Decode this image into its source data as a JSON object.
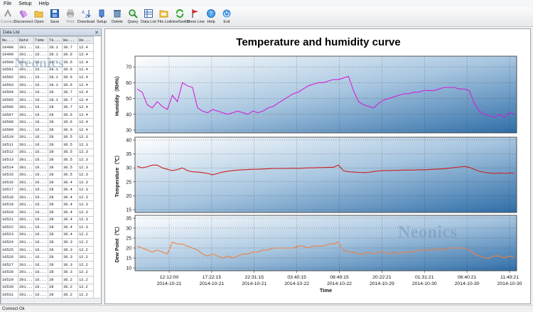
{
  "menu": [
    "File",
    "Setup",
    "Help"
  ],
  "toolbar": [
    {
      "label": "Connect",
      "icon": "connect-icon",
      "disabled": true
    },
    {
      "label": "Disconnect",
      "icon": "disconnect-icon",
      "disabled": false
    },
    {
      "label": "Open",
      "icon": "folder-open-icon",
      "disabled": false
    },
    {
      "label": "Save",
      "icon": "save-icon",
      "disabled": false
    },
    {
      "label": "Print",
      "icon": "print-icon",
      "disabled": true
    },
    {
      "label": "Download",
      "icon": "download-icon",
      "disabled": false
    },
    {
      "label": "Setup",
      "icon": "setup-icon",
      "disabled": false
    },
    {
      "label": "Delete",
      "icon": "delete-icon",
      "disabled": false
    },
    {
      "label": "Query",
      "icon": "query-icon",
      "disabled": false
    },
    {
      "label": "Data List",
      "icon": "data-list-icon",
      "disabled": false
    },
    {
      "label": "File List",
      "icon": "file-list-icon",
      "disabled": false
    },
    {
      "label": "ViewSwitch",
      "icon": "view-switch-icon",
      "disabled": false
    },
    {
      "label": "Show Line",
      "icon": "show-line-icon",
      "disabled": false
    },
    {
      "label": "Help",
      "icon": "help-icon",
      "disabled": false
    },
    {
      "label": "Exit",
      "icon": "exit-icon",
      "disabled": false
    }
  ],
  "data_list": {
    "title": "Data List",
    "columns": [
      "Nu...",
      "Date",
      "Time",
      "Te...",
      "Hu...",
      "De..."
    ],
    "rows": [
      [
        "10498",
        "201...",
        "16...",
        "28.1",
        "36.7",
        "12.4"
      ],
      [
        "10499",
        "201...",
        "16...",
        "28.1",
        "36.6",
        "12.4"
      ],
      [
        "10500",
        "201...",
        "16...",
        "28.1",
        "36.6",
        "12.4"
      ],
      [
        "10501",
        "201...",
        "16...",
        "28.1",
        "36.6",
        "12.4"
      ],
      [
        "10502",
        "201...",
        "16...",
        "28.1",
        "36.6",
        "12.4"
      ],
      [
        "10503",
        "201...",
        "16...",
        "28.1",
        "36.6",
        "12.4"
      ],
      [
        "10504",
        "201...",
        "16...",
        "28",
        "36.7",
        "12.4"
      ],
      [
        "10505",
        "201...",
        "16...",
        "28.1",
        "36.7",
        "12.4"
      ],
      [
        "10506",
        "201...",
        "16...",
        "28",
        "36.7",
        "12.4"
      ],
      [
        "10507",
        "201...",
        "16...",
        "28",
        "36.6",
        "12.4"
      ],
      [
        "10508",
        "201...",
        "16...",
        "28",
        "36.6",
        "12.4"
      ],
      [
        "10509",
        "201...",
        "16...",
        "28",
        "36.6",
        "12.4"
      ],
      [
        "10510",
        "201...",
        "16...",
        "28",
        "36.5",
        "12.3"
      ],
      [
        "10511",
        "201...",
        "16...",
        "28",
        "36.5",
        "12.3"
      ],
      [
        "10512",
        "201...",
        "16...",
        "28",
        "36.5",
        "12.3"
      ],
      [
        "10513",
        "201...",
        "16...",
        "28",
        "36.5",
        "12.3"
      ],
      [
        "10514",
        "201...",
        "16...",
        "28",
        "36.5",
        "12.3"
      ],
      [
        "10515",
        "201...",
        "16...",
        "28",
        "36.5",
        "12.3"
      ],
      [
        "10516",
        "201...",
        "16...",
        "28",
        "36.4",
        "12.3"
      ],
      [
        "10517",
        "201...",
        "16...",
        "28",
        "36.4",
        "12.3"
      ],
      [
        "10518",
        "201...",
        "16...",
        "28",
        "36.4",
        "12.3"
      ],
      [
        "10519",
        "201...",
        "16...",
        "28",
        "36.4",
        "12.3"
      ],
      [
        "10520",
        "201...",
        "16...",
        "28",
        "36.4",
        "12.3"
      ],
      [
        "10521",
        "201...",
        "16...",
        "28",
        "36.4",
        "12.3"
      ],
      [
        "10522",
        "201...",
        "16...",
        "28",
        "36.4",
        "12.3"
      ],
      [
        "10523",
        "201...",
        "16...",
        "28",
        "36.4",
        "12.2"
      ],
      [
        "10524",
        "201...",
        "16...",
        "28",
        "36.3",
        "12.2"
      ],
      [
        "10525",
        "201...",
        "16...",
        "28",
        "36.3",
        "12.2"
      ],
      [
        "10526",
        "201...",
        "16...",
        "28",
        "36.3",
        "12.2"
      ],
      [
        "10527",
        "201...",
        "16...",
        "28",
        "36.3",
        "12.2"
      ],
      [
        "10528",
        "201...",
        "16...",
        "28",
        "36.3",
        "12.2"
      ],
      [
        "10529",
        "201...",
        "16...",
        "28",
        "36.2",
        "12.2"
      ],
      [
        "10530",
        "201...",
        "16...",
        "28",
        "36.2",
        "12.2"
      ],
      [
        "10531",
        "201...",
        "16...",
        "28",
        "36.2",
        "12.2"
      ],
      [
        "10532",
        "201...",
        "16...",
        "28",
        "36.2",
        "12.2"
      ]
    ]
  },
  "watermark": "Neonics",
  "status": "Connect Ok",
  "chart_data": {
    "type": "line",
    "title": "Temperature and humidity curve",
    "xlabel": "Time",
    "x_ticks": [
      {
        "time": "12:12:00",
        "date": "2014-10-21"
      },
      {
        "time": "17:22:15",
        "date": "2014-10-21"
      },
      {
        "time": "22:31:15",
        "date": "2014-10-21"
      },
      {
        "time": "03:40:15",
        "date": "2014-10-22"
      },
      {
        "time": "08:49:15",
        "date": "2014-10-22"
      },
      {
        "time": "20:22:21",
        "date": "2014-10-29"
      },
      {
        "time": "01:31:21",
        "date": "2014-10-30"
      },
      {
        "time": "06:40:21",
        "date": "2014-10-30"
      },
      {
        "time": "11:49:21",
        "date": "2014-10-30"
      }
    ],
    "grid": true,
    "panels": [
      {
        "ylabel": "Humidity（RH%）",
        "ylim": [
          30,
          75
        ],
        "yticks": [
          30,
          40,
          50,
          60,
          70
        ],
        "color": "#d020d8",
        "values": [
          56,
          54,
          46,
          44,
          48,
          45,
          43,
          52,
          48,
          60,
          58,
          57,
          44,
          42,
          41,
          43,
          42,
          41,
          40,
          41,
          42,
          41,
          40,
          42,
          41,
          42,
          44,
          45,
          47,
          49,
          51,
          53,
          54,
          56,
          58,
          59,
          60,
          60,
          61,
          62,
          62,
          63,
          64,
          55,
          48,
          46,
          45,
          44,
          47,
          49,
          50,
          51,
          52,
          53,
          53,
          54,
          54,
          55,
          55,
          55,
          56,
          57,
          57,
          57,
          56,
          56,
          55,
          47,
          42,
          40,
          39,
          38,
          40,
          38,
          41,
          40
        ]
      },
      {
        "ylabel": "Temperature（℃）",
        "ylim": [
          15,
          40
        ],
        "yticks": [
          15,
          20,
          25,
          30,
          35,
          40
        ],
        "color": "#cc2020",
        "values": [
          30.5,
          30,
          30.4,
          31,
          31,
          30,
          29.5,
          29,
          29.4,
          30,
          29,
          28.6,
          28.5,
          28.3,
          28,
          27.5,
          28,
          28.5,
          28.8,
          29,
          29.2,
          29.3,
          29.4,
          29.5,
          29.5,
          29.6,
          29.7,
          29.8,
          29.8,
          29.8,
          29.8,
          29.9,
          29.8,
          29.9,
          30,
          30,
          30.1,
          30.1,
          30.2,
          30.2,
          31,
          29,
          28.6,
          28.5,
          28.4,
          28.3,
          28.4,
          28.7,
          28.9,
          29,
          29,
          29.1,
          29.1,
          29.2,
          29.2,
          29.2,
          29.3,
          29.3,
          29.4,
          29.5,
          29.6,
          29.7,
          29.9,
          30.1,
          30.3,
          30.5,
          30.2,
          29.5,
          28.8,
          28.4,
          28.1,
          28,
          28.1,
          28,
          28.2,
          28
        ]
      },
      {
        "ylabel": "Dew Point（℃）",
        "ylim": [
          10,
          35
        ],
        "yticks": [
          10,
          15,
          20,
          25,
          30,
          35
        ],
        "color": "#f08040",
        "values": [
          21,
          20,
          19,
          18,
          19,
          18,
          17,
          23,
          22,
          22,
          21,
          20,
          19,
          17,
          16,
          17,
          16,
          15,
          16,
          15,
          16,
          17,
          17,
          18,
          18,
          19,
          19,
          20,
          20,
          20,
          20,
          20,
          21,
          21,
          20,
          21,
          21,
          21,
          22,
          22,
          23,
          19,
          18,
          18,
          17,
          17,
          18,
          17,
          18,
          18,
          17,
          18,
          17,
          18,
          18,
          18,
          19,
          19,
          19,
          19,
          20,
          19,
          20,
          20,
          20,
          20,
          19,
          17,
          16,
          15,
          15,
          16,
          16,
          15,
          16,
          15
        ]
      }
    ]
  }
}
